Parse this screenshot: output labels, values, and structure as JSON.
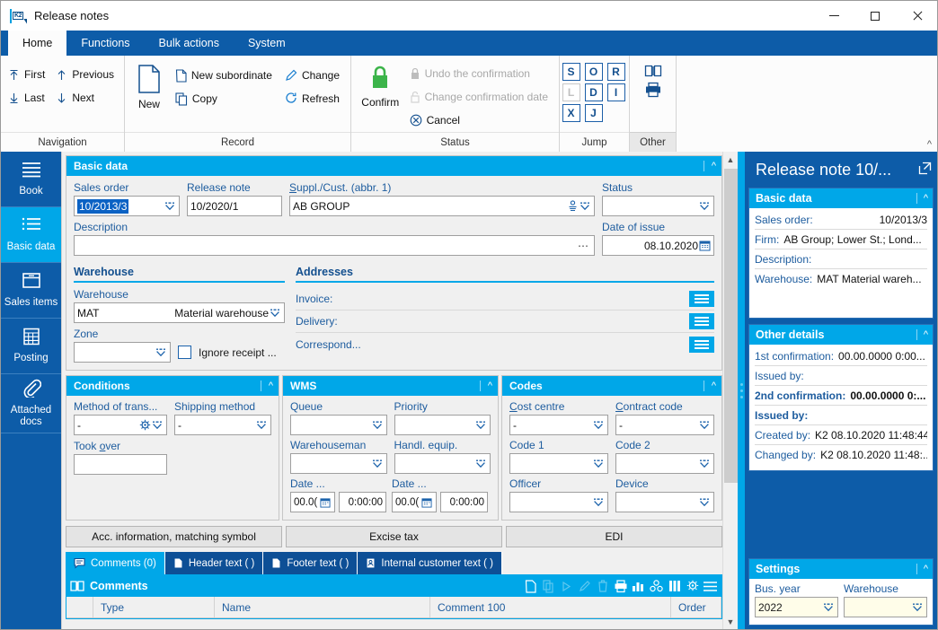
{
  "window": {
    "title": "Release notes",
    "app_icon": "k2-icon",
    "minimize": "minimize-icon",
    "maximize": "maximize-icon",
    "close": "close-icon"
  },
  "ribbon": {
    "tabs": [
      {
        "label": "Home",
        "active": true
      },
      {
        "label": "Functions",
        "active": false
      },
      {
        "label": "Bulk actions",
        "active": false
      },
      {
        "label": "System",
        "active": false
      }
    ],
    "groups": [
      {
        "name": "Navigation",
        "label": "Navigation",
        "items": [
          {
            "label": "First",
            "icon": "first-arrow-icon",
            "disabled": false
          },
          {
            "label": "Last",
            "icon": "last-arrow-icon",
            "disabled": false
          },
          {
            "label": "Previous",
            "icon": "up-arrow-icon",
            "disabled": false
          },
          {
            "label": "Next",
            "icon": "down-arrow-icon",
            "disabled": false
          }
        ]
      },
      {
        "name": "Record",
        "label": "Record",
        "big": {
          "label": "New",
          "icon": "new-document-icon"
        },
        "items": [
          {
            "label": "New subordinate",
            "icon": "document-icon",
            "disabled": false
          },
          {
            "label": "Copy",
            "icon": "copy-icon",
            "disabled": false
          },
          {
            "label": "Change",
            "icon": "pencil-icon",
            "disabled": false
          },
          {
            "label": "Refresh",
            "icon": "refresh-icon",
            "disabled": false
          }
        ]
      },
      {
        "name": "Status",
        "label": "Status",
        "big": {
          "label": "Confirm",
          "icon": "green-padlock-icon"
        },
        "items": [
          {
            "label": "Undo the confirmation",
            "icon": "padlock-icon",
            "disabled": true
          },
          {
            "label": "Change confirmation date",
            "icon": "padlock-open-icon",
            "disabled": true
          },
          {
            "label": "Cancel",
            "icon": "cancel-circle-icon",
            "disabled": false
          }
        ]
      },
      {
        "name": "Jump",
        "label": "Jump",
        "buttons": [
          {
            "label": "S",
            "disabled": false
          },
          {
            "label": "O",
            "disabled": false
          },
          {
            "label": "R",
            "disabled": false
          },
          {
            "label": "L",
            "disabled": true
          },
          {
            "label": "D",
            "disabled": false
          },
          {
            "label": "I",
            "disabled": false
          },
          {
            "label": "X",
            "disabled": false
          },
          {
            "label": "J",
            "disabled": false
          }
        ]
      },
      {
        "name": "Other",
        "label": "Other",
        "items": [
          {
            "label": "",
            "icon": "book-icon"
          },
          {
            "label": "",
            "icon": "printer-icon"
          }
        ]
      }
    ],
    "collapse_icon": "chevron-up-icon"
  },
  "sidebar": {
    "items": [
      {
        "label": "Book",
        "icon": "lines-icon",
        "active": false
      },
      {
        "label": "Basic data",
        "icon": "list-icon",
        "active": true
      },
      {
        "label": "Sales items",
        "icon": "box-icon",
        "active": false
      },
      {
        "label": "Posting",
        "icon": "calculator-icon",
        "active": false
      },
      {
        "label": "Attached docs",
        "icon": "paperclip-icon",
        "active": false
      }
    ]
  },
  "basic_data": {
    "title": "Basic data",
    "collapse_icon": "chevron-up-icon",
    "sales_order": {
      "label": "Sales order",
      "value": "10/2013/3",
      "selected": true
    },
    "release_note": {
      "label": "Release note",
      "value": "10/2020/1"
    },
    "supplier": {
      "label": "Suppl./Cust. (abbr. 1)",
      "value": "AB GROUP",
      "icons": [
        "contacts-icon",
        "chevron-down-icon"
      ]
    },
    "status": {
      "label": "Status",
      "value": ""
    },
    "description": {
      "label": "Description",
      "value": "",
      "more_icon": "ellipsis-icon"
    },
    "date_of_issue": {
      "label": "Date of issue",
      "value": "08.10.2020",
      "icon": "calendar-icon"
    }
  },
  "warehouse_section": {
    "title": "Warehouse",
    "warehouse": {
      "label": "Warehouse",
      "code": "MAT",
      "name": "Material warehouse"
    },
    "zone": {
      "label": "Zone",
      "value": ""
    },
    "ignore_receipt": {
      "label": "Ignore receipt ...",
      "checked": false
    }
  },
  "addresses_section": {
    "title": "Addresses",
    "rows": [
      {
        "label": "Invoice:",
        "value": "",
        "button_icon": "list-button-icon"
      },
      {
        "label": "Delivery:",
        "value": "",
        "button_icon": "list-button-icon"
      },
      {
        "label": "Correspond...",
        "value": "",
        "button_icon": "list-button-icon"
      }
    ]
  },
  "conditions": {
    "title": "Conditions",
    "collapse_icon": "chevron-up-icon",
    "method_of_transport": {
      "label": "Method of trans...",
      "value": "-",
      "icons": [
        "gear-icon",
        "chevron-down-icon"
      ]
    },
    "shipping_method": {
      "label": "Shipping method",
      "value": "-"
    },
    "took_over": {
      "label": "Took over",
      "value": ""
    }
  },
  "wms": {
    "title": "WMS",
    "collapse_icon": "chevron-up-icon",
    "queue": {
      "label": "Queue",
      "value": ""
    },
    "priority": {
      "label": "Priority",
      "value": ""
    },
    "warehouseman": {
      "label": "Warehouseman",
      "value": ""
    },
    "handling_equipment": {
      "label": "Handl. equip.",
      "value": ""
    },
    "date1": {
      "label": "Date ...",
      "date": "00.0(",
      "time": "0:00:00",
      "icon": "calendar-icon"
    },
    "date2": {
      "label": "Date ...",
      "date": "00.0(",
      "time": "0:00:00",
      "icon": "calendar-icon"
    }
  },
  "codes": {
    "title": "Codes",
    "collapse_icon": "chevron-up-icon",
    "cost_centre": {
      "label": "Cost centre",
      "value": "-"
    },
    "contract_code": {
      "label": "Contract code",
      "value": "-"
    },
    "code1": {
      "label": "Code 1",
      "value": ""
    },
    "code2": {
      "label": "Code 2",
      "value": ""
    },
    "officer": {
      "label": "Officer",
      "value": ""
    },
    "device": {
      "label": "Device",
      "value": ""
    }
  },
  "bottom_buttons": [
    {
      "label": "Acc. information, matching symbol"
    },
    {
      "label": "Excise tax"
    },
    {
      "label": "EDI"
    }
  ],
  "tabs": [
    {
      "label": "Comments (0)",
      "icon": "comment-icon",
      "active": true
    },
    {
      "label": "Header text ( )",
      "icon": "document-icon",
      "active": false
    },
    {
      "label": "Footer text ( )",
      "icon": "document-icon",
      "active": false
    },
    {
      "label": "Internal customer text ( )",
      "icon": "document-person-icon",
      "active": false
    }
  ],
  "comments_grid": {
    "title": "Comments",
    "title_icon": "book-open-icon",
    "tools": [
      {
        "icon": "new-record-icon",
        "disabled": false
      },
      {
        "icon": "copy-record-icon",
        "disabled": true
      },
      {
        "icon": "run-icon",
        "disabled": true
      },
      {
        "icon": "edit-icon",
        "disabled": true
      },
      {
        "icon": "delete-icon",
        "disabled": true
      },
      {
        "icon": "print-icon",
        "disabled": false
      },
      {
        "icon": "chart-icon",
        "disabled": false
      },
      {
        "icon": "group-icon",
        "disabled": false
      },
      {
        "icon": "columns-icon",
        "disabled": false
      },
      {
        "icon": "settings-icon",
        "disabled": false
      },
      {
        "icon": "menu-icon",
        "disabled": false
      }
    ],
    "columns": [
      "Type",
      "Name",
      "Comment 100",
      "Order"
    ],
    "rows": []
  },
  "right_pane": {
    "title": "Release note 10/...",
    "expand_icon": "open-external-icon",
    "basic_data": {
      "title": "Basic data",
      "collapse_icon": "chevron-up-icon",
      "rows": [
        {
          "key": "Sales order:",
          "value": "10/2013/3",
          "align": "right",
          "bold": false
        },
        {
          "key": "Firm:",
          "value": "AB Group; Lower St.; Lond...",
          "align": "left",
          "bold": false
        },
        {
          "key": "Description:",
          "value": "",
          "align": "left",
          "bold": false
        },
        {
          "key": "Warehouse:",
          "value": "MAT Material wareh...",
          "align": "left",
          "bold": false
        }
      ]
    },
    "other_details": {
      "title": "Other details",
      "collapse_icon": "chevron-up-icon",
      "rows": [
        {
          "key": "1st confirmation:",
          "value": "00.00.0000 0:00...",
          "bold": false
        },
        {
          "key": "Issued by:",
          "value": "",
          "bold": false
        },
        {
          "key": "2nd confirmation:",
          "value": "00.00.0000 0:...",
          "bold": true
        },
        {
          "key": "Issued by:",
          "value": "",
          "bold": true
        },
        {
          "key": "Created by:",
          "value": "K2 08.10.2020 11:48:44",
          "bold": false
        },
        {
          "key": "Changed by:",
          "value": "K2 08.10.2020 11:48:...",
          "bold": false
        }
      ]
    },
    "settings": {
      "title": "Settings",
      "collapse_icon": "chevron-up-icon",
      "bus_year": {
        "label": "Bus. year",
        "value": "2022"
      },
      "warehouse": {
        "label": "Warehouse",
        "value": ""
      }
    }
  },
  "colors": {
    "ribbon_blue": "#0d5ca8",
    "panel_cyan": "#00a7e8",
    "selection_blue": "#0b62c4",
    "label_blue": "#1d5c9e",
    "confirm_green": "#3cb44a",
    "settings_field": "#fffde9"
  }
}
